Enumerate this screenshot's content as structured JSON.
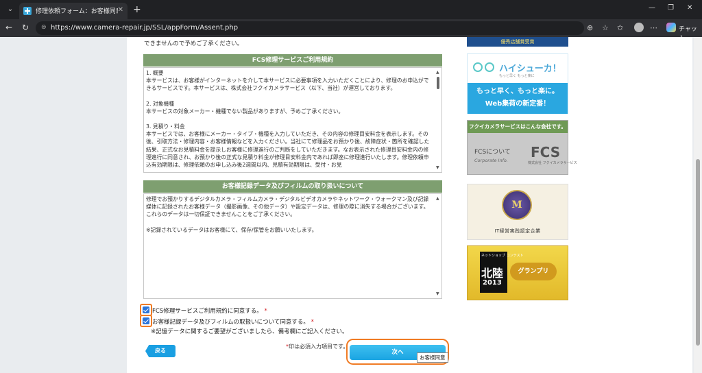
{
  "browser": {
    "tab_title": "修理依頼フォーム：お客様同意｜株",
    "url": "https://www.camera-repair.jp/SSL/appForm/Assent.php",
    "chat_label": "チャット"
  },
  "page": {
    "top_note": "できませんので予めご了承ください。",
    "terms_section": {
      "heading": "FCS修理サービスご利用規約",
      "body": [
        "1. 概要\n本サービスは、お客様がインターネットを介して本サービスに必要事項を入力いただくことにより、修理のお申込ができるサービスです。本サービスは、株式会社フクイカメラサービス（以下、当社）が運営しております。",
        "2. 対象機種\n本サービスの対象メーカー・機種でない製品がありますが、予めご了承ください。",
        "3. 見積り・料金\n本サービスでは、お客様にメーカー・タイプ・機種を入力していただき、その内容の修理目安料金を表示します。その後、引取方法・修理内容・お客様情報などを入力ください。当社にて修理品をお預かり後、故障症状・箇所を確認した結果、正式なお見積料金を提示しお客様に修理進行のご判断をしていただきます。なお表示された修理目安料金内の修理進行に同意され、お預かり後の正式な見積り料金が修理目安料金内であれば即座に修理進行いたします。修理依頼申込有効期限は、修理依頼のお申し込み後2週間以内、見積有効期限は、受付・お見"
      ]
    },
    "data_section": {
      "heading": "お客様記録データ及びフィルムの取り扱いについて",
      "body": [
        "修理でお預かりするデジタルカメラ・フィルムカメラ・デジタルビデオカメラやネットワーク・ウォークマン及び記録媒体に記録されたお客様データ（撮影画像、その他データ）や設定データは、修理の際に消失する場合がございます。これらのデータは一切保証できませんことをご了承ください。",
        "※記録されているデータはお客様にて、保存/保管をお願いいたします。"
      ]
    },
    "checkbox_terms": {
      "label": "FCS修理サービスご利用規約に同意する。",
      "required_mark": "*",
      "checked": true
    },
    "checkbox_data": {
      "label": "お客様記録データ及びフィルムの取扱いについて同意する。",
      "required_mark": "*",
      "checked": true
    },
    "memo_note": "※記憶データに関するご要望がございましたら、備考欄にご記入ください。",
    "required_note_mark": "*",
    "required_note": "印は必須入力項目です。",
    "back_button": "戻る",
    "next_button": "次へ",
    "tooltip": "お客様同意"
  },
  "sidebar": {
    "banner_top": "優秀店舗賞受賞",
    "hi_shuka": {
      "name": "ハイシューカ！",
      "sub": "もっと早く もっと楽に",
      "line1": "もっと早く、もっと楽に。",
      "line2": "Web集荷の新定番！"
    },
    "fcs": {
      "heading": "フクイカメラサービスはこんな会社です。",
      "line1": "FCSについて",
      "line2": "Corporate Info.",
      "big": "FCS",
      "small": "株式会社 フクイカメラサービス"
    },
    "it": {
      "medal": "M",
      "text": "IT経営実践認定企業"
    },
    "hokuriku": {
      "top": "ネットショップ コンテスト",
      "name": "北陸",
      "year": "2013",
      "prize": "グランプリ"
    }
  },
  "colors": {
    "section_head": "#7e9f70",
    "accent_ring": "#f07b24",
    "button_blue": "#1aa4e2",
    "required": "#d6242a"
  }
}
